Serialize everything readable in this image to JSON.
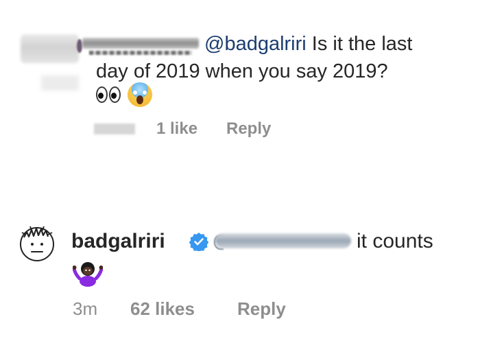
{
  "comment1": {
    "mention": "@badgalriri",
    "text_line1": " Is it the last",
    "text_line2": "day of 2019 when you say 2019?",
    "emojis": [
      "eyes-emoji",
      "screaming-face-emoji"
    ],
    "likes": "1 like",
    "reply_label": "Reply"
  },
  "comment2": {
    "username": "badgalriri",
    "verified": true,
    "text": "it counts",
    "emojis": [
      "person-shrugging-emoji"
    ],
    "time": "3m",
    "likes": "62 likes",
    "reply_label": "Reply"
  },
  "colors": {
    "text": "#262626",
    "meta": "#8e8e8e",
    "mention": "#1c3d70",
    "verified_badge": "#3897f0"
  }
}
